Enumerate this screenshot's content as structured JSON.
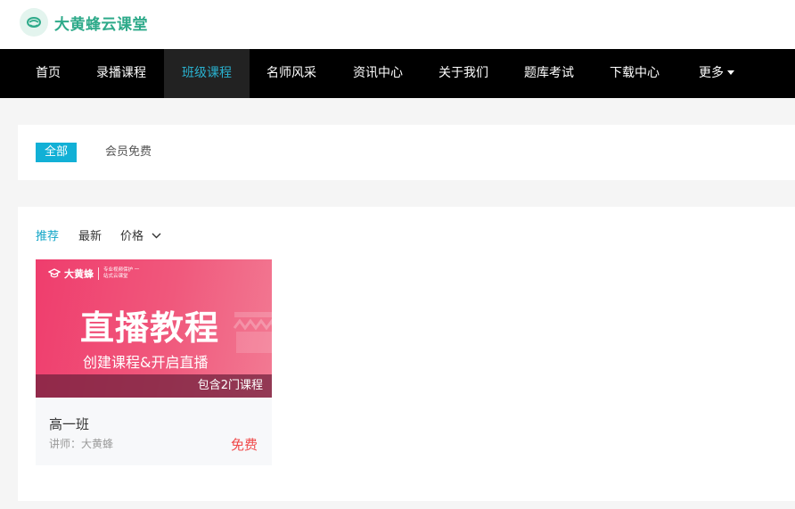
{
  "header": {
    "logo_text": "大黄蜂云课堂",
    "brand_color": "#2eaa8a"
  },
  "nav": {
    "items": [
      {
        "label": "首页"
      },
      {
        "label": "录播课程"
      },
      {
        "label": "班级课程",
        "active": true
      },
      {
        "label": "名师风采"
      },
      {
        "label": "资讯中心"
      },
      {
        "label": "关于我们"
      },
      {
        "label": "题库考试"
      },
      {
        "label": "下载中心"
      },
      {
        "label": "更多"
      }
    ],
    "active_color": "#2ab1cf"
  },
  "filters": {
    "items": [
      {
        "label": "全部",
        "active": true
      },
      {
        "label": "会员免费"
      }
    ]
  },
  "sort": {
    "recommend": "推荐",
    "newest": "最新",
    "price": "价格"
  },
  "courses": [
    {
      "thumb_brand": "大黄蜂",
      "thumb_slogan": "专业视频保护 一站式云课堂",
      "thumb_title": "直播教程",
      "thumb_subtitle": "创建课程&开启直播",
      "thumb_count": "包含2门课程",
      "title": "高一班",
      "lecturer": "讲师：大黄蜂",
      "price": "免费",
      "price_color": "#f04b4b"
    }
  ]
}
